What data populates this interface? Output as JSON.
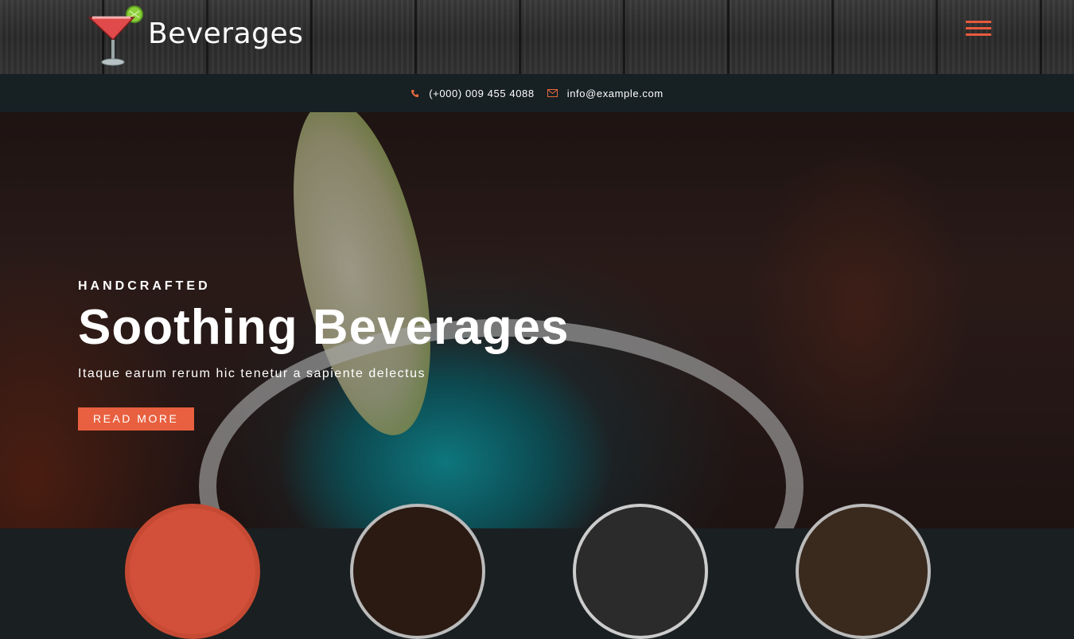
{
  "brand": {
    "name": "Beverages",
    "logo_icon": "cocktail-glass-icon"
  },
  "contact": {
    "phone_icon": "phone-icon",
    "phone": "(+000) 009 455 4088",
    "email_icon": "envelope-icon",
    "email": "info@example.com"
  },
  "hero": {
    "eyebrow": "HANDCRAFTED",
    "title": "Soothing Beverages",
    "subtitle": "Itaque earum rerum hic tenetur a sapiente delectus",
    "button": "READ MORE"
  },
  "colors": {
    "accent": "#e8603f",
    "infobar": "#172023",
    "header": "#2f2f2f"
  }
}
